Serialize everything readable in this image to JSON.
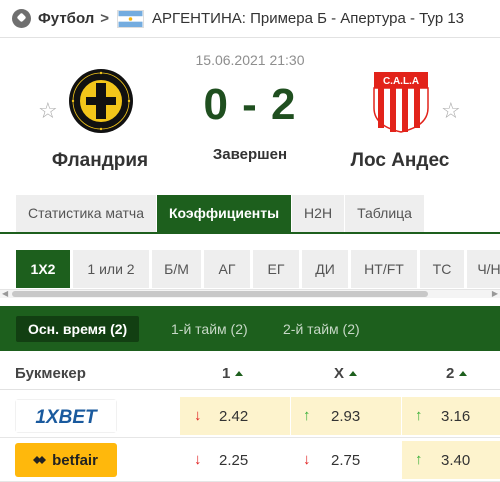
{
  "breadcrumb": {
    "sport_icon": "soccer-ball-icon",
    "sport": "Футбол",
    "separator": ">",
    "country_flag": "argentina-flag-icon",
    "tournament": "АРГЕНТИНА: Примера Б - Апертура - Тур 13"
  },
  "match": {
    "datetime": "15.06.2021 21:30",
    "score": "0 - 2",
    "status": "Завершен",
    "home": {
      "name": "Фландрия",
      "logo_text": "1° DE FEBRERO DE 1914 · CLUB SOCIAL Y DEPORTIVO FLANDRIA",
      "favorite_icon": "star-outline-icon"
    },
    "away": {
      "name": "Лос Андес",
      "logo_text": "C.A.L.A",
      "favorite_icon": "star-outline-icon"
    }
  },
  "tabs": [
    {
      "label": "Статистика матча",
      "active": false
    },
    {
      "label": "Коэффициенты",
      "active": true
    },
    {
      "label": "H2H",
      "active": false
    },
    {
      "label": "Таблица",
      "active": false
    }
  ],
  "markets": [
    {
      "label": "1X2",
      "active": true
    },
    {
      "label": "1 или 2",
      "active": false
    },
    {
      "label": "Б/М",
      "active": false
    },
    {
      "label": "АГ",
      "active": false
    },
    {
      "label": "ЕГ",
      "active": false
    },
    {
      "label": "ДИ",
      "active": false
    },
    {
      "label": "HT/FT",
      "active": false
    },
    {
      "label": "ТС",
      "active": false
    },
    {
      "label": "Ч/Н",
      "active": false
    }
  ],
  "periods": [
    {
      "label": "Осн. время (2)",
      "active": true
    },
    {
      "label": "1-й тайм (2)",
      "active": false
    },
    {
      "label": "2-й тайм (2)",
      "active": false
    }
  ],
  "table": {
    "headers": {
      "bookmaker": "Букмекер",
      "c1": "1",
      "cx": "X",
      "c2": "2"
    },
    "rows": [
      {
        "bookmaker": "1XBET",
        "odds": [
          "2.42",
          "2.93",
          "3.16"
        ],
        "trend": [
          "down",
          "up",
          "up"
        ]
      },
      {
        "bookmaker": "betfair",
        "odds": [
          "2.25",
          "2.75",
          "3.40"
        ],
        "trend": [
          "down",
          "down",
          "up"
        ]
      }
    ]
  },
  "colors": {
    "accent_green": "#1d5f1d",
    "highlight": "#fdf3cd",
    "up": "#39b039",
    "down": "#e02020",
    "betfair": "#ffb80c",
    "onexbet_blue": "#1a5a9e"
  }
}
